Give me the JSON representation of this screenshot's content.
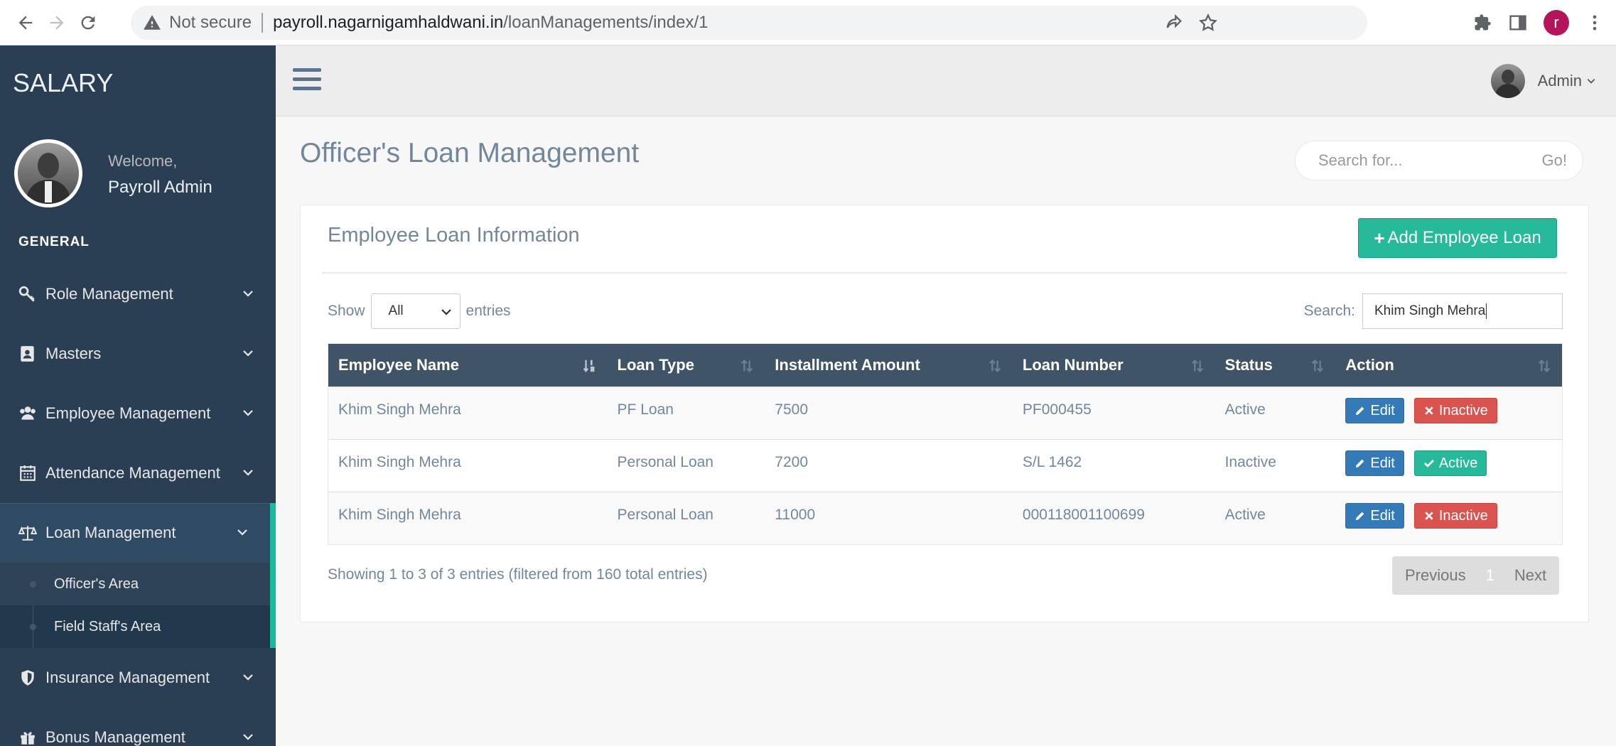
{
  "browser": {
    "security_label": "Not secure",
    "url_host": "payroll.nagarnigamhaldwani.in",
    "url_path": "/loanManagements/index/1",
    "profile_initial": "r",
    "profile_color": "#b5135a"
  },
  "sidebar": {
    "brand": "SALARY",
    "welcome": "Welcome,",
    "username": "Payroll Admin",
    "section": "GENERAL",
    "items": [
      {
        "label": "Role Management",
        "icon": "key-icon"
      },
      {
        "label": "Masters",
        "icon": "contact-book-icon"
      },
      {
        "label": "Employee Management",
        "icon": "users-icon"
      },
      {
        "label": "Attendance Management",
        "icon": "calendar-icon"
      },
      {
        "label": "Loan Management",
        "icon": "balance-scale-icon"
      },
      {
        "label": "Insurance Management",
        "icon": "shield-icon"
      },
      {
        "label": "Bonus Management",
        "icon": "gift-icon"
      }
    ],
    "submenu": [
      {
        "label": "Officer's Area"
      },
      {
        "label": "Field Staff's Area"
      }
    ],
    "colors": {
      "background": "#2a3f54",
      "accent": "#1abb9c"
    }
  },
  "topnav": {
    "user": "Admin"
  },
  "main": {
    "title": "Officer's Loan Management",
    "search_placeholder": "Search for...",
    "search_go": "Go!",
    "panel": {
      "title": "Employee Loan Information",
      "add_button": "Add Employee Loan",
      "show_label": "Show",
      "show_value": "All",
      "entries_label": "entries",
      "search_label": "Search:",
      "search_value": "Khim Singh Mehra",
      "columns": [
        "Employee Name",
        "Loan Type",
        "Installment Amount",
        "Loan Number",
        "Status",
        "Action"
      ],
      "rows": [
        {
          "name": "Khim Singh Mehra",
          "type": "PF Loan",
          "amount": "7500",
          "number": "PF000455",
          "status": "Active",
          "edit": "Edit",
          "toggle": "Inactive",
          "toggle_kind": "inactive"
        },
        {
          "name": "Khim Singh Mehra",
          "type": "Personal Loan",
          "amount": "7200",
          "number": "S/L 1462",
          "status": "Inactive",
          "edit": "Edit",
          "toggle": "Active",
          "toggle_kind": "active"
        },
        {
          "name": "Khim Singh Mehra",
          "type": "Personal Loan",
          "amount": "11000",
          "number": "000118001100699",
          "status": "Active",
          "edit": "Edit",
          "toggle": "Inactive",
          "toggle_kind": "inactive"
        }
      ],
      "info": "Showing 1 to 3 of 3 entries (filtered from 160 total entries)",
      "pager": {
        "previous": "Previous",
        "current": "1",
        "next": "Next"
      }
    },
    "colors": {
      "header": "#405467",
      "success": "#26b99a",
      "danger": "#d9534f",
      "primary": "#337ab7"
    }
  }
}
